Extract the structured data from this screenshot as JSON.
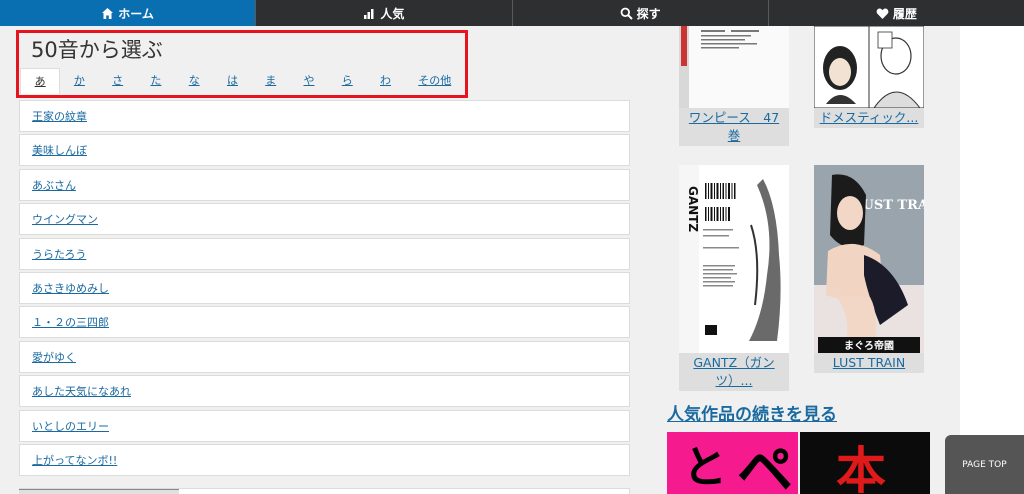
{
  "nav": {
    "items": [
      {
        "label": "ホーム",
        "icon": "home-icon",
        "active": true
      },
      {
        "label": "人気",
        "icon": "bar-chart-icon",
        "active": false
      },
      {
        "label": "探す",
        "icon": "search-icon",
        "active": false
      },
      {
        "label": "履歴",
        "icon": "heart-icon",
        "active": false
      }
    ]
  },
  "section": {
    "title": "50音から選ぶ"
  },
  "kana_tabs": [
    "あ",
    "か",
    "さ",
    "た",
    "な",
    "は",
    "ま",
    "や",
    "ら",
    "わ",
    "その他"
  ],
  "titles": [
    "王家の紋章",
    "美味しんぼ",
    "あぶさん",
    "ウイングマン",
    "うらたろう",
    "あさきゆめみし",
    "１・２の三四郎",
    "愛がゆく",
    "あした天気になあれ",
    "いとしのエリー",
    "上がってなンボ!!"
  ],
  "books": [
    {
      "caption": "ワンピース　47巻"
    },
    {
      "caption": "ドメスティック..."
    },
    {
      "caption": "GANTZ（ガンツ）..."
    },
    {
      "caption": "LUST TRAIN"
    }
  ],
  "cover_texts": {
    "gantz_spine": "GANTZ",
    "lust_title": "LUST TRAIN",
    "lust_author": "まぐろ帝國"
  },
  "more_link": "人気作品の続きを見る",
  "promos": [
    {
      "text": "と",
      "bg": "#f51b8e"
    },
    {
      "text": "ペ",
      "bg": "#f51b8e"
    },
    {
      "text": "本",
      "bg": "#0b0b0b"
    }
  ],
  "page_top": "PAGE TOP",
  "colors": {
    "nav_bg": "#2e2f31",
    "nav_active": "#0a6fb0",
    "link": "#1a6aa0",
    "highlight": "#e5141e"
  }
}
